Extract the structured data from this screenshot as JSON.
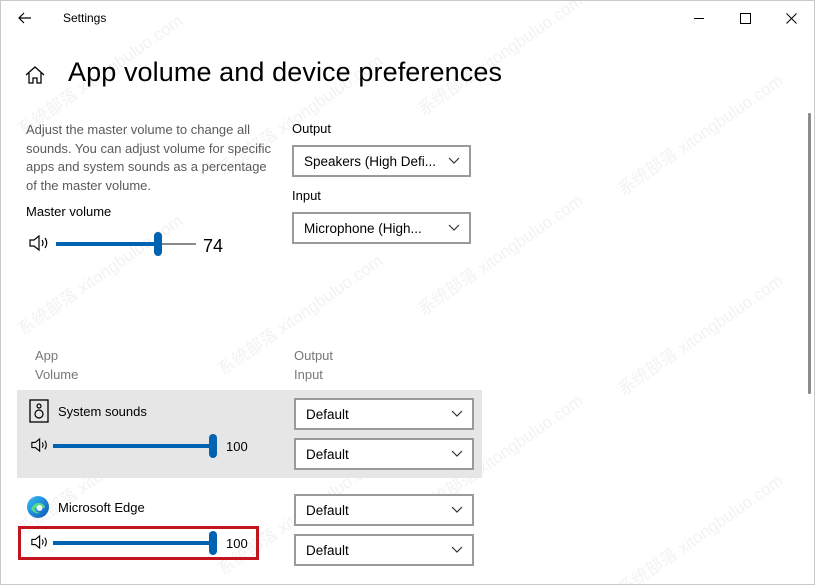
{
  "window": {
    "app_title": "Settings",
    "controls": {
      "minimize": "minimize-icon",
      "maximize": "maximize-icon",
      "close": "close-icon"
    }
  },
  "page": {
    "title": "App volume and device preferences",
    "description": "Adjust the master volume to change all sounds. You can adjust volume for specific apps and system sounds as a percentage of the master volume."
  },
  "master": {
    "label": "Master volume",
    "value": "74",
    "level": 0.74
  },
  "output": {
    "label": "Output",
    "selected": "Speakers (High Defi..."
  },
  "input": {
    "label": "Input",
    "selected": "Microphone (High..."
  },
  "columns": {
    "app": "App",
    "volume": "Volume",
    "output": "Output",
    "input": "Input"
  },
  "apps": [
    {
      "name": "System sounds",
      "icon": "speaker-box-icon",
      "volume": "100",
      "level": 1.0,
      "output": "Default",
      "input": "Default"
    },
    {
      "name": "Microsoft Edge",
      "icon": "edge-logo-icon",
      "volume": "100",
      "level": 1.0,
      "output": "Default",
      "input": "Default"
    }
  ],
  "watermark": "系统部落 xitongbuluo.com",
  "colors": {
    "accent": "#0063b1",
    "highlight": "#c4141d",
    "row_background": "#e6e6e6"
  }
}
